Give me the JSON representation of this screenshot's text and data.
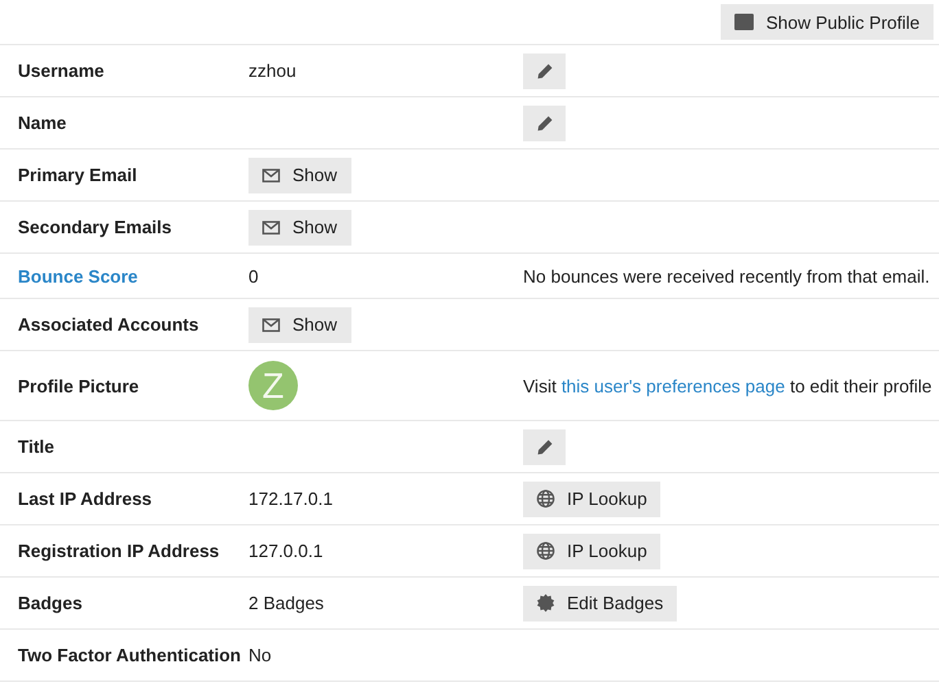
{
  "top_button": {
    "label": "Show Public Profile"
  },
  "rows": [
    {
      "label": {
        "kind": "text",
        "text": "Username"
      },
      "value": {
        "kind": "text",
        "text": "zzhou"
      },
      "action": {
        "kind": "edit"
      }
    },
    {
      "label": {
        "kind": "text",
        "text": "Name"
      },
      "action": {
        "kind": "edit"
      }
    },
    {
      "label": {
        "kind": "text",
        "text": "Primary Email"
      },
      "value": {
        "kind": "mail",
        "text": "Show"
      }
    },
    {
      "label": {
        "kind": "text",
        "text": "Secondary Emails"
      },
      "value": {
        "kind": "mail",
        "text": "Show"
      }
    },
    {
      "label": {
        "kind": "link",
        "text": "Bounce Score"
      },
      "value": {
        "kind": "text",
        "text": "0"
      },
      "action": {
        "kind": "note",
        "text": "No bounces were received recently from that email."
      }
    },
    {
      "label": {
        "kind": "text",
        "text": "Associated Accounts"
      },
      "value": {
        "kind": "mail",
        "text": "Show"
      }
    },
    {
      "label": {
        "kind": "text",
        "text": "Profile Picture"
      },
      "value": {
        "kind": "avatar",
        "text": "Z"
      },
      "action": {
        "kind": "link_note",
        "before": "Visit",
        "link": "this user's preferences page",
        "after": "to edit their profile"
      }
    },
    {
      "label": {
        "kind": "text",
        "text": "Title"
      },
      "action": {
        "kind": "edit"
      }
    },
    {
      "label": {
        "kind": "text",
        "text": "Last IP Address"
      },
      "value": {
        "kind": "text",
        "text": "172.17.0.1"
      },
      "action": {
        "kind": "globe",
        "text": "IP Lookup"
      }
    },
    {
      "label": {
        "kind": "text",
        "text": "Registration IP Address"
      },
      "value": {
        "kind": "text",
        "text": "127.0.0.1"
      },
      "action": {
        "kind": "globe",
        "text": "IP Lookup"
      }
    },
    {
      "label": {
        "kind": "text",
        "text": "Badges"
      },
      "value": {
        "kind": "text",
        "text": "2 Badges"
      },
      "action": {
        "kind": "badge",
        "text": "Edit Badges"
      }
    },
    {
      "label": {
        "kind": "text",
        "text": "Two Factor Authentication"
      },
      "value": {
        "kind": "text",
        "text": "No"
      }
    }
  ]
}
